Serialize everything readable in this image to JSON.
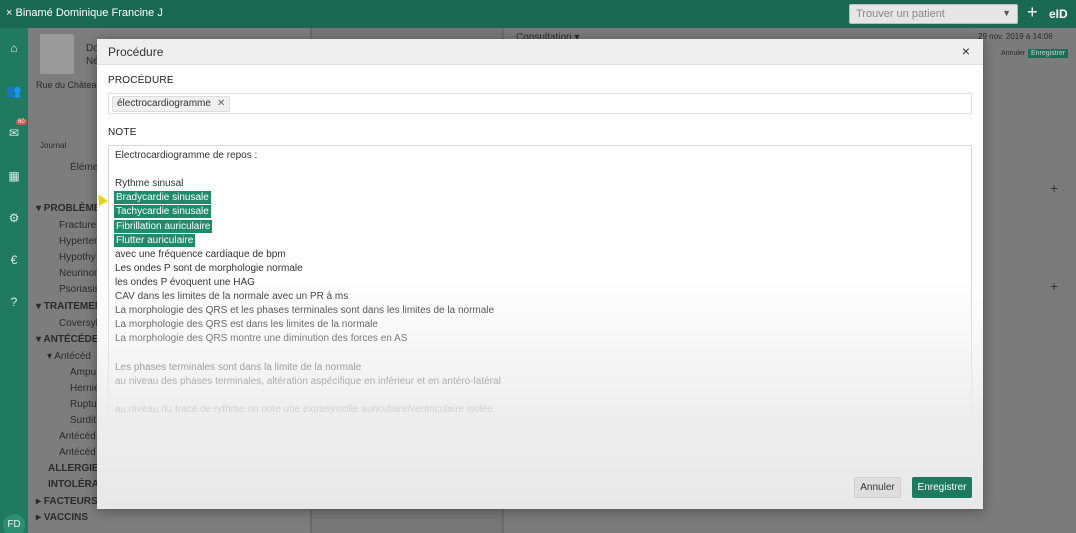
{
  "topbar": {
    "patient_tab": "× Binamé Dominique Francine J",
    "search_placeholder": "Trouver un patient",
    "plus": "+",
    "eid": "eID"
  },
  "left_panel": {
    "name_partial": "Do",
    "name_partial2": "Né",
    "address_partial": "Rue du Château",
    "tab_journal": "Journal",
    "tab_elements": "Élémen",
    "tree": [
      {
        "label": "▾ PROBLÈME",
        "bold": true
      },
      {
        "label": "Fracture",
        "bold": false
      },
      {
        "label": "Hyperten",
        "bold": false
      },
      {
        "label": "Hypothy",
        "bold": false
      },
      {
        "label": "Neurinom",
        "bold": false
      },
      {
        "label": "Psoriasis",
        "bold": false
      },
      {
        "label": "▾ TRAITEMEN",
        "bold": true
      },
      {
        "label": "Coversyl",
        "bold": false
      },
      {
        "label": "▾ ANTÉCÉDE",
        "bold": true
      },
      {
        "label": "▾ Antécéd",
        "bold": false
      },
      {
        "label": "Ampu",
        "bold": false
      },
      {
        "label": "Hernie",
        "bold": false
      },
      {
        "label": "Ruptu",
        "bold": false
      },
      {
        "label": "Surdit",
        "bold": false
      },
      {
        "label": "Antécéd",
        "bold": false
      },
      {
        "label": "Antécéd",
        "bold": false
      },
      {
        "label": "ALLERGIES",
        "bold": true
      },
      {
        "label": "INTOLÉRAN",
        "bold": true
      },
      {
        "label": "▸ FACTEURS",
        "bold": true
      },
      {
        "label": "▸ VACCINS",
        "bold": true
      }
    ]
  },
  "right_panel": {
    "consultation": "Consultation ▾",
    "date": "29 nov. 2019 à 14:06",
    "annuler": "Annuler",
    "enregistrer": "Enregistrer"
  },
  "rail": {
    "badge": "60",
    "user_initials": "FD"
  },
  "modal": {
    "title": "Procédure",
    "close": "×",
    "procedure_label": "PROCÉDURE",
    "procedure_tag": "électrocardiogramme",
    "note_label": "NOTE",
    "note_lines": [
      {
        "text": "Electrocardiogramme de repos :",
        "hl": false
      },
      {
        "text": "",
        "hl": false
      },
      {
        "text": "Rythme sinusal",
        "hl": false
      },
      {
        "text": "Bradycardie sinusale",
        "hl": true
      },
      {
        "text": "Tachycardie sinusale",
        "hl": true
      },
      {
        "text": "Fibrillation auriculaire",
        "hl": true
      },
      {
        "text": "Flutter auriculaire",
        "hl": true
      },
      {
        "text": "avec une fréquence cardiaque de   bpm",
        "hl": false
      },
      {
        "text": "Les ondes P sont de morphologie normale",
        "hl": false
      },
      {
        "text": "les ondes P évoquent une HAG",
        "hl": false
      },
      {
        "text": "CAV dans les limites de la normale avec un PR à  ms",
        "hl": false
      },
      {
        "text": "La morphologie des QRS et les phases terminales sont dans les limites de la normale",
        "hl": false
      },
      {
        "text": "La morphologie des QRS est dans les limites de la normale",
        "hl": false
      },
      {
        "text": "La morphologie des QRS montre une diminution des forces en AS",
        "hl": false
      },
      {
        "text": "",
        "hl": false
      },
      {
        "text": "Les phases terminales sont dans la limite de la normale",
        "hl": false
      },
      {
        "text": "au niveau des phases terminales, altération aspécifique en inférieur et en antéro-latéral",
        "hl": false
      },
      {
        "text": "",
        "hl": false
      },
      {
        "text": "au niveau du tracé de rythme on note une extrasystolie auriculaire/ventriculaire isolée",
        "hl": false
      }
    ],
    "cancel": "Annuler",
    "save": "Enregistrer"
  }
}
